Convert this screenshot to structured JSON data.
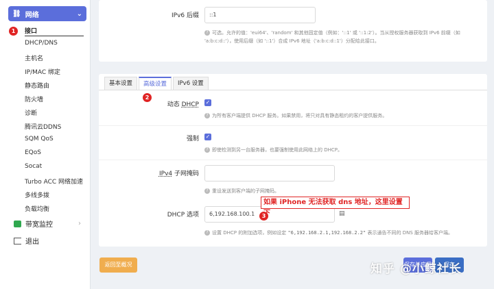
{
  "sidebar": {
    "group_network": "网络",
    "items": [
      "接口",
      "DHCP/DNS",
      "主机名",
      "IP/MAC 绑定",
      "静态路由",
      "防火墙",
      "诊断",
      "腾讯云DDNS",
      "SQM QoS",
      "EQoS",
      "Socat",
      "Turbo ACC 网络加速",
      "多线多拨",
      "负载均衡"
    ],
    "group_bandwidth": "带宽监控",
    "logout": "退出"
  },
  "badges": [
    "1",
    "2",
    "3"
  ],
  "ipv6_suffix": {
    "label": "IPv6 后缀",
    "value": "::1",
    "help_line1": "可选。允许的值：'eui64'、'random' 和其他固定值（例如：'::1' 或 '::1:2'）。当从授权服务器获取到 IPv6 前缀（如",
    "help_line2": "'a:b:c:d::'），使用后缀（如 '::1'）合成 IPv6 地址（'a:b:c:d::1'）分配给此接口。"
  },
  "tabs": [
    "基本设置",
    "高级设置",
    "IPv6 设置"
  ],
  "dynamic_dhcp": {
    "label_prefix": "动态 ",
    "label_abbr": "DHCP",
    "help": "为所有客户端提供 DHCP 服务。如果禁用，将只对具有静态租约的客户提供服务。"
  },
  "force": {
    "label": "强制",
    "help": "即使检测到另一台服务器，也要强制使用此网络上的 DHCP。"
  },
  "ipv4_mask": {
    "label_abbr": "IPv4",
    "label_suffix": " 子网掩码",
    "value": "",
    "help": "重设发送到客户端的子网掩码。"
  },
  "dhcp_option": {
    "label": "DHCP 选项",
    "value": "6,192.168.100.1",
    "help_prefix": "设置 DHCP 的附加选项，例如设定 ",
    "help_code": "\"6,192.168.2.1,192.168.2.2\"",
    "help_suffix": " 表示通告不同的 DNS 服务器给客户端。"
  },
  "annotation": "如果 iPhone 无法获取 dns 地址，这里设置下",
  "buttons": {
    "back": "返回至概况",
    "save_apply": "保存并应用",
    "save": "保存"
  },
  "watermark": "知乎 @小鲸社长"
}
